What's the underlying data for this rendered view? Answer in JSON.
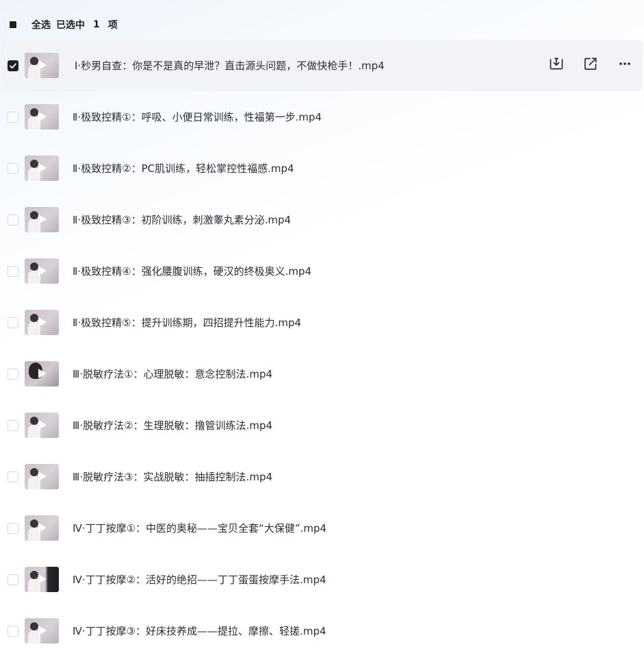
{
  "header": {
    "select_all": "全选",
    "selected_prefix": "已选中",
    "selected_count": "1",
    "selected_suffix": "项"
  },
  "files": [
    {
      "name": "Ⅰ·秒男自查：你是不是真的早泄？直击源头问题，不做快枪手！.mp4",
      "selected": true
    },
    {
      "name": "Ⅱ·极致控精①：呼吸、小便日常训练，性福第一步.mp4",
      "selected": false
    },
    {
      "name": "Ⅱ·极致控精②：PC肌训练，轻松掌控性福感.mp4",
      "selected": false
    },
    {
      "name": "Ⅱ·极致控精③：初阶训练，刺激睾丸素分泌.mp4",
      "selected": false
    },
    {
      "name": "Ⅱ·极致控精④：强化腰腹训练，硬汉的终极奥义.mp4",
      "selected": false
    },
    {
      "name": "Ⅱ·极致控精⑤：提升训练期，四招提升性能力.mp4",
      "selected": false
    },
    {
      "name": "Ⅲ·脱敏疗法①：心理脱敏：意念控制法.mp4",
      "selected": false
    },
    {
      "name": "Ⅲ·脱敏疗法②：生理脱敏：撸管训练法.mp4",
      "selected": false
    },
    {
      "name": "Ⅲ·脱敏疗法③：实战脱敏：抽插控制法.mp4",
      "selected": false
    },
    {
      "name": "Ⅳ·丁丁按摩①：中医的奥秘——宝贝全套“大保健”.mp4",
      "selected": false
    },
    {
      "name": "Ⅳ·丁丁按摩②：活好的绝招——丁丁蛋蛋按摩手法.mp4",
      "selected": false
    },
    {
      "name": "Ⅳ·丁丁按摩③：好床技养成——提拉、摩擦、轻搓.mp4",
      "selected": false
    }
  ],
  "row_actions": {
    "download_icon": "download-icon",
    "share_icon": "share-external-icon",
    "more_icon": "more-horizontal-icon"
  },
  "colors": {
    "text": "#2b2c31",
    "checked": "#1f2023",
    "selected_row_bg": "#f1f3f6"
  }
}
